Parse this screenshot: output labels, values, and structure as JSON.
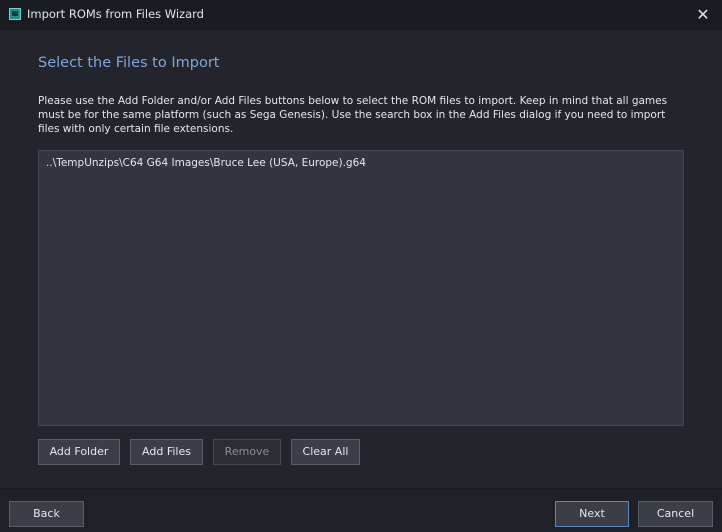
{
  "window": {
    "title": "Import ROMs from Files Wizard",
    "close_glyph": "✕",
    "icon": "app-icon"
  },
  "page": {
    "heading": "Select the Files to Import",
    "instructions": "Please use the Add Folder and/or Add Files buttons below to select the ROM files to import. Keep in mind that all games must be for the same platform (such as Sega Genesis). Use the search box in the Add Files dialog if you need to import files with only certain file extensions."
  },
  "file_list": {
    "items": [
      "..\\TempUnzips\\C64 G64 Images\\Bruce Lee (USA, Europe).g64"
    ]
  },
  "actions": {
    "add_folder": "Add Folder",
    "add_files": "Add Files",
    "remove": "Remove",
    "clear_all": "Clear All"
  },
  "nav": {
    "back": "Back",
    "next": "Next",
    "cancel": "Cancel"
  },
  "colors": {
    "background": "#24252c",
    "titlebar": "#1b1c21",
    "heading": "#7da6e0",
    "list_background": "#33353f",
    "button": "#3b3d47"
  }
}
